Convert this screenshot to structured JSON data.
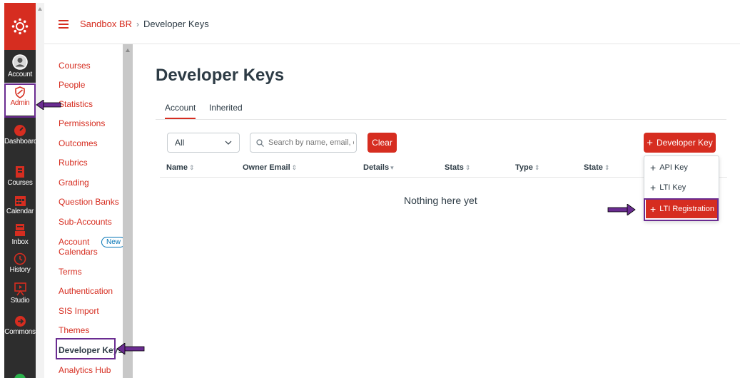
{
  "global_nav": {
    "items": [
      {
        "id": "account",
        "label": "Account",
        "icon": "user-icon"
      },
      {
        "id": "admin",
        "label": "Admin",
        "icon": "shield-icon",
        "active": true
      },
      {
        "id": "dashboard",
        "label": "Dashboard",
        "icon": "dashboard-icon"
      },
      {
        "id": "courses",
        "label": "Courses",
        "icon": "book-icon"
      },
      {
        "id": "calendar",
        "label": "Calendar",
        "icon": "calendar-icon"
      },
      {
        "id": "inbox",
        "label": "Inbox",
        "icon": "inbox-icon"
      },
      {
        "id": "history",
        "label": "History",
        "icon": "clock-icon"
      },
      {
        "id": "studio",
        "label": "Studio",
        "icon": "studio-icon"
      },
      {
        "id": "commons",
        "label": "Commons",
        "icon": "commons-icon"
      }
    ]
  },
  "breadcrumb": {
    "root": "Sandbox BR",
    "separator": "›",
    "current": "Developer Keys"
  },
  "sub_nav": {
    "items": [
      "Courses",
      "People",
      "Statistics",
      "Permissions",
      "Outcomes",
      "Rubrics",
      "Grading",
      "Question Banks",
      "Sub-Accounts",
      "Account Calendars",
      "Terms",
      "Authentication",
      "SIS Import",
      "Themes",
      "Developer Keys",
      "Analytics Hub"
    ],
    "active": "Developer Keys",
    "new_badge": "New"
  },
  "main": {
    "title": "Developer Keys",
    "tabs": [
      {
        "label": "Account",
        "active": true
      },
      {
        "label": "Inherited",
        "active": false
      }
    ],
    "filter": {
      "value": "All"
    },
    "search": {
      "placeholder": "Search by name, email, or ID"
    },
    "clear_label": "Clear",
    "add_button": {
      "label": "Developer Key"
    },
    "columns": [
      "Name",
      "Owner Email",
      "Details",
      "Stats",
      "Type",
      "State"
    ],
    "empty_message": "Nothing here yet",
    "menu": [
      "API Key",
      "LTI Key",
      "LTI Registration"
    ]
  },
  "colors": {
    "brand": "#d62d20",
    "nav_bg": "#2d2d2d",
    "annotation": "#6a2c91"
  }
}
